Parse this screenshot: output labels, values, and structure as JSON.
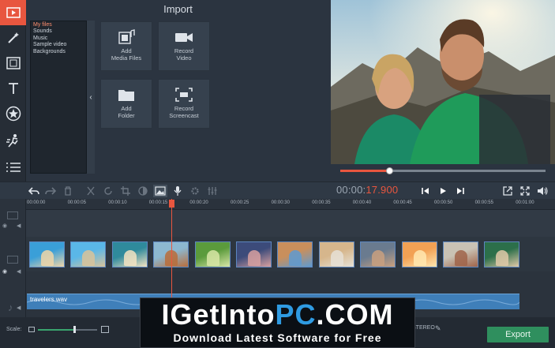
{
  "import": {
    "title": "Import",
    "tree": [
      "My files",
      "Sounds",
      "Music",
      "Sample video",
      "Backgrounds"
    ],
    "tiles": [
      {
        "line1": "Add",
        "line2": "Media Files",
        "icon": "media-files-icon"
      },
      {
        "line1": "Record",
        "line2": "Video",
        "icon": "camera-icon"
      },
      {
        "line1": "Add",
        "line2": "Folder",
        "icon": "folder-icon"
      },
      {
        "line1": "Record",
        "line2": "Screencast",
        "icon": "screencast-icon"
      }
    ]
  },
  "rail": [
    "import-icon",
    "magic-wand-icon",
    "filmstrip-icon",
    "text-icon",
    "star-icon",
    "motion-icon",
    "menu-icon"
  ],
  "player": {
    "progress": 0.24,
    "timecode_gray": "00:00:",
    "timecode_red": "17.900"
  },
  "timeline": {
    "ticks": [
      "00:00:00",
      "00:00:05",
      "00:00:10",
      "00:00:15",
      "00:00:20",
      "00:00:25",
      "00:00:30",
      "00:00:35",
      "00:00:40",
      "00:00:45",
      "00:00:50",
      "00:00:55",
      "00:01:00"
    ],
    "audio_clip": "travelers.wav"
  },
  "bottom": {
    "scale_label": "Scale:",
    "stereo": "STEREO",
    "export": "Export"
  },
  "watermark": {
    "title_a": "IGetInto",
    "title_b": "PC",
    "title_c": ".COM",
    "subtitle": "Download Latest Software for Free"
  },
  "colors": {
    "accent": "#e8563f",
    "clip_border": "#5c86bf",
    "audio": "#3f7fb9",
    "export": "#2f8f5e"
  }
}
